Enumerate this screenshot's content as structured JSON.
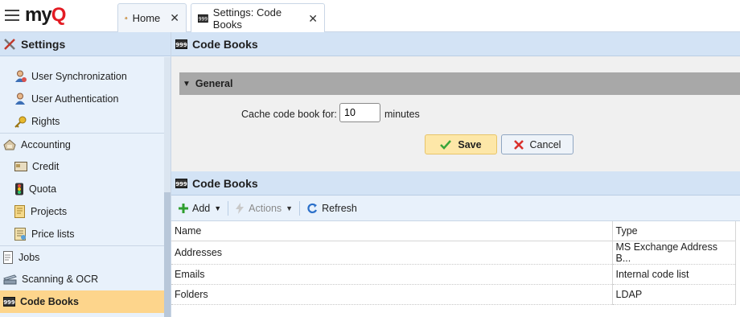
{
  "app": {
    "logo_main": "my",
    "logo_accent": "Q"
  },
  "tabs": [
    {
      "label": "Home",
      "icon": "home-icon"
    },
    {
      "label": "Settings: Code Books",
      "icon": "codebook-icon"
    }
  ],
  "sidebar": {
    "title": "Settings",
    "items": [
      {
        "label": "User Synchronization",
        "icon": "user-sync-icon"
      },
      {
        "label": "User Authentication",
        "icon": "user-auth-icon"
      },
      {
        "label": "Rights",
        "icon": "key-icon"
      },
      {
        "label": "Accounting",
        "icon": "accounting-icon"
      },
      {
        "label": "Credit",
        "icon": "credit-icon"
      },
      {
        "label": "Quota",
        "icon": "quota-icon"
      },
      {
        "label": "Projects",
        "icon": "projects-icon"
      },
      {
        "label": "Price lists",
        "icon": "price-list-icon"
      },
      {
        "label": "Jobs",
        "icon": "jobs-icon"
      },
      {
        "label": "Scanning & OCR",
        "icon": "scanner-icon"
      },
      {
        "label": "Code Books",
        "icon": "codebook-icon"
      }
    ]
  },
  "main": {
    "title": "Code Books",
    "general": {
      "title": "General",
      "cache_label": "Cache code book for:",
      "cache_value": "10",
      "cache_unit": "minutes",
      "save_label": "Save",
      "cancel_label": "Cancel"
    },
    "codebooks": {
      "title": "Code Books",
      "toolbar": {
        "add": "Add",
        "actions": "Actions",
        "refresh": "Refresh"
      },
      "columns": [
        "Name",
        "Type"
      ],
      "rows": [
        [
          "Addresses",
          "MS Exchange Address B..."
        ],
        [
          "Emails",
          "Internal code list"
        ],
        [
          "Folders",
          "LDAP"
        ]
      ]
    }
  },
  "colors": {
    "selected": "#fdd58c",
    "accent": "#e31b23",
    "save": "#fde7a8"
  }
}
